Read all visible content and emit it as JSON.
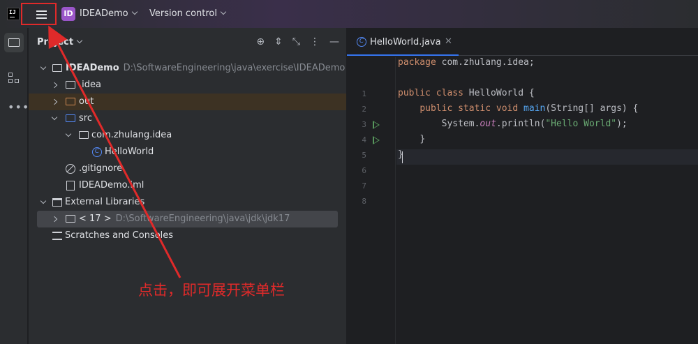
{
  "titlebar": {
    "logo_text": "IJ",
    "project_badge": "ID",
    "project_name": "IDEADemo",
    "version_control": "Version control"
  },
  "project_panel": {
    "title": "Project",
    "tree": [
      {
        "label": "IDEADemo",
        "path": "D:\\SoftwareEngineering\\java\\exercise\\IDEADemo"
      },
      {
        "label": ".idea"
      },
      {
        "label": "out"
      },
      {
        "label": "src"
      },
      {
        "label": "com.zhulang.idea"
      },
      {
        "label": "HelloWorld"
      },
      {
        "label": ".gitignore"
      },
      {
        "label": "IDEADemo.iml"
      },
      {
        "label": "External Libraries"
      },
      {
        "label": "< 17 >",
        "path": "D:\\SoftwareEngineering\\java\\jdk\\jdk17"
      },
      {
        "label": "Scratches and Consoles"
      }
    ]
  },
  "editor": {
    "tab_name": "HelloWorld.java",
    "line_numbers": [
      "1",
      "2",
      "3",
      "4",
      "5",
      "6",
      "7",
      "8"
    ],
    "code": {
      "l1_kw": "package",
      "l1_rest": " com.zhulang.idea;",
      "l3_kw": "public class",
      "l3_rest": " HelloWorld {",
      "l4_kw": "public static void",
      "l4_fn": "main",
      "l4_rest": "(String[] args) {",
      "l5_a": "System.",
      "l5_field": "out",
      "l5_b": ".println(",
      "l5_str": "\"Hello World\"",
      "l5_c": ");",
      "l6": "}",
      "l7": "}"
    }
  },
  "annotation": {
    "text": "点击，即可展开菜单栏",
    "color": "#e02a2a"
  },
  "colors": {
    "accent": "#3574f0",
    "keyword": "#cf8e6d",
    "string": "#6aab73",
    "method": "#56a8f5"
  }
}
